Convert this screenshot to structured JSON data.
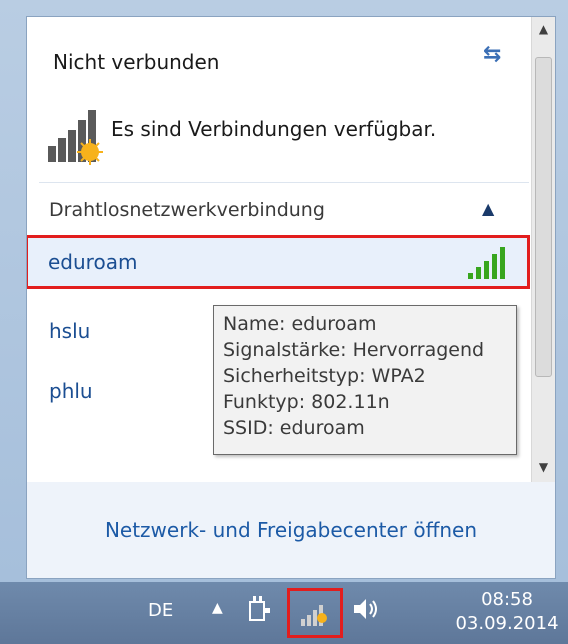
{
  "header": {
    "title": "Nicht verbunden",
    "availability": "Es sind Verbindungen verfügbar."
  },
  "section": {
    "label": "Drahtlosnetzwerkverbindung"
  },
  "networks": [
    {
      "name": "eduroam",
      "signal_bars": 5,
      "selected": true
    },
    {
      "name": "hslu",
      "selected": false
    },
    {
      "name": "phlu",
      "selected": false
    }
  ],
  "tooltip": {
    "lines": [
      "Name: eduroam",
      "Signalstärke: Hervorragend",
      "Sicherheitstyp: WPA2",
      "Funktyp: 802.11n",
      "SSID: eduroam"
    ]
  },
  "footer": {
    "link": "Netzwerk- und Freigabecenter öffnen"
  },
  "taskbar": {
    "language": "DE",
    "time": "08:58",
    "date": "03.09.2014"
  },
  "icons": {
    "refresh": "refresh-icon",
    "collapse": "chevron-up-icon",
    "signal": "signal-bars-icon",
    "power": "power-plug-icon",
    "network": "network-icon",
    "volume": "speaker-icon"
  },
  "colors": {
    "highlight_border": "#e21d1d",
    "link": "#1b4e92",
    "signal_green": "#38a61e"
  }
}
